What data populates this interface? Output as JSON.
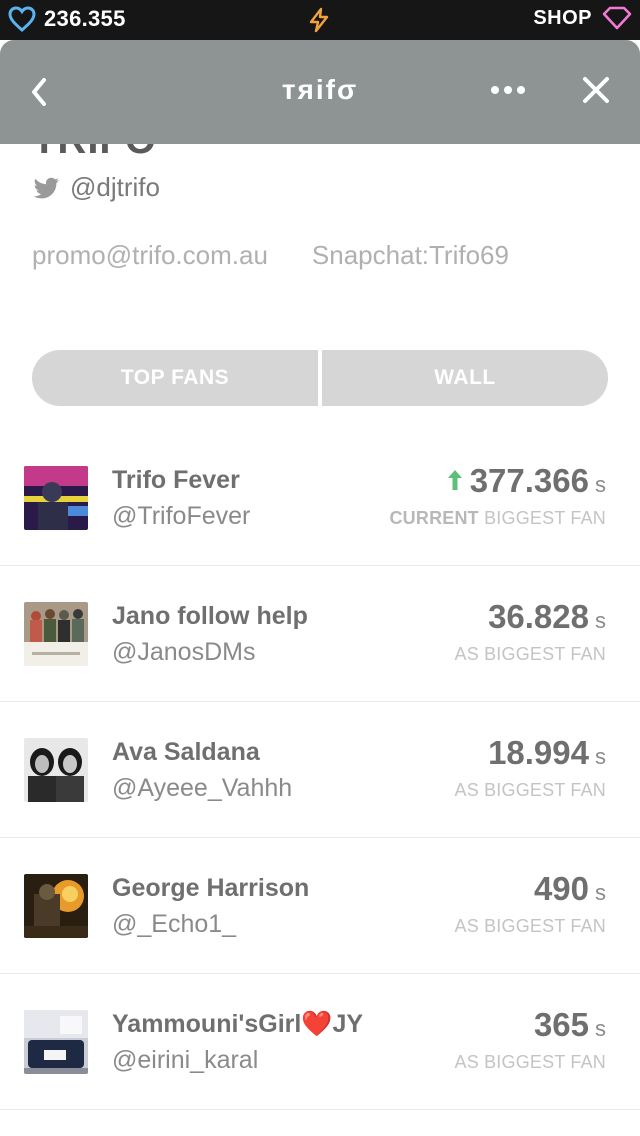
{
  "status_bar": {
    "hearts": "236.355",
    "shop_label": "SHOP"
  },
  "header": {
    "title": "тяifσ"
  },
  "profile": {
    "name": "TRIFO",
    "twitter_handle": "@djtrifo",
    "email": "promo@trifo.com.au",
    "snapchat": "Snapchat:Trifo69"
  },
  "tabs": {
    "top_fans": "TOP FANS",
    "wall": "WALL"
  },
  "score_unit": "s",
  "fans": [
    {
      "name": "Trifo Fever",
      "handle": "@TrifoFever",
      "score": "377.366",
      "sub_strong": "CURRENT",
      "sub": "BIGGEST FAN",
      "trend": "up"
    },
    {
      "name": "Jano follow help",
      "handle": "@JanosDMs",
      "score": "36.828",
      "sub_strong": "",
      "sub": "AS BIGGEST FAN"
    },
    {
      "name": "Ava Saldana",
      "handle": "@Ayeee_Vahhh",
      "score": "18.994",
      "sub_strong": "",
      "sub": "AS BIGGEST FAN"
    },
    {
      "name": "George Harrison",
      "handle": "@_Echo1_",
      "score": "490",
      "sub_strong": "",
      "sub": "AS BIGGEST FAN"
    },
    {
      "name": "Yammouni'sGirl❤️JY",
      "handle": "@eirini_karal",
      "score": "365",
      "sub_strong": "",
      "sub": "AS BIGGEST FAN"
    }
  ],
  "colors": {
    "header_bg": "#8e9394",
    "accent_heart": "#5ab4f0",
    "bolt": "#f0a23c",
    "shop_gem": "#f27ad6",
    "trend_up": "#5cc07a"
  }
}
